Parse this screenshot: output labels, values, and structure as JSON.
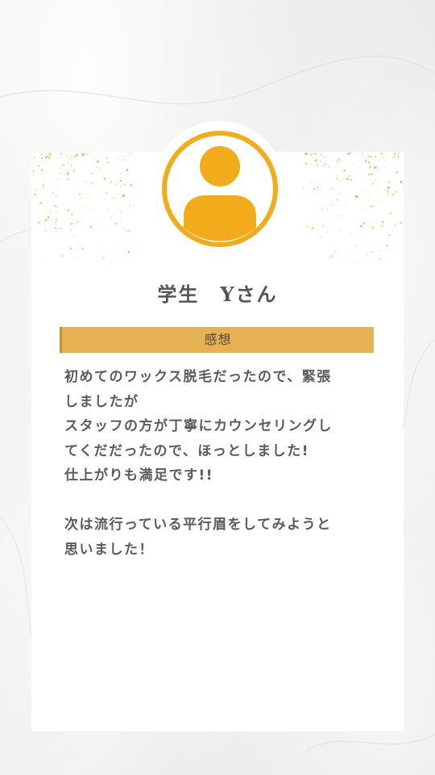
{
  "profile": {
    "name": "学生　Yさん",
    "avatar_icon": "person-icon",
    "accent_color": "#f2ab1b"
  },
  "section": {
    "heading": "感想",
    "bar_color": "#e4b153"
  },
  "testimonial": {
    "lines": [
      "初めてのワックス脱毛だったので、緊張",
      "しましたが",
      "スタッフの方が丁寧にカウンセリングし",
      "てくだだったので、ほっとしました!",
      "仕上がりも満足です!!",
      "",
      "次は流行っている平行眉をしてみようと",
      "思いました！"
    ]
  }
}
